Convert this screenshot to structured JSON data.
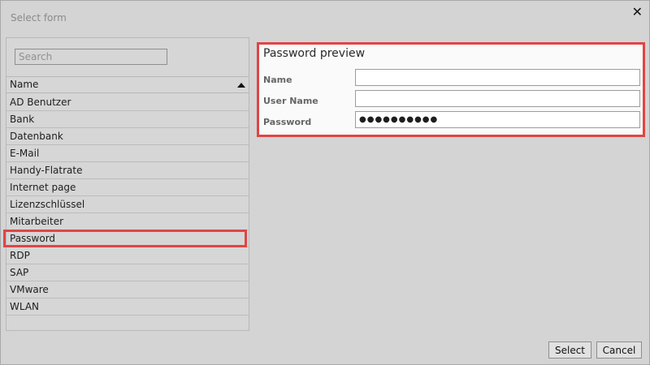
{
  "window": {
    "title": "Select form"
  },
  "search": {
    "placeholder": "Search",
    "value": ""
  },
  "list": {
    "header": "Name",
    "items": [
      "AD Benutzer",
      "Bank",
      "Datenbank",
      "E-Mail",
      "Handy-Flatrate",
      "Internet page",
      "Lizenzschlüssel",
      "Mitarbeiter",
      "Password",
      "RDP",
      "SAP",
      "VMware",
      "WLAN"
    ],
    "selected": "Password"
  },
  "preview": {
    "title": "Password preview",
    "fields": {
      "name": {
        "label": "Name",
        "value": ""
      },
      "username": {
        "label": "User Name",
        "value": ""
      },
      "password": {
        "label": "Password",
        "value": "●●●●●●●●●●"
      }
    }
  },
  "buttons": {
    "select": "Select",
    "cancel": "Cancel"
  },
  "colors": {
    "highlight": "#e04545",
    "background": "#d4d4d4"
  },
  "icons": {
    "close": "close-icon",
    "sort": "sort-ascending-icon"
  }
}
